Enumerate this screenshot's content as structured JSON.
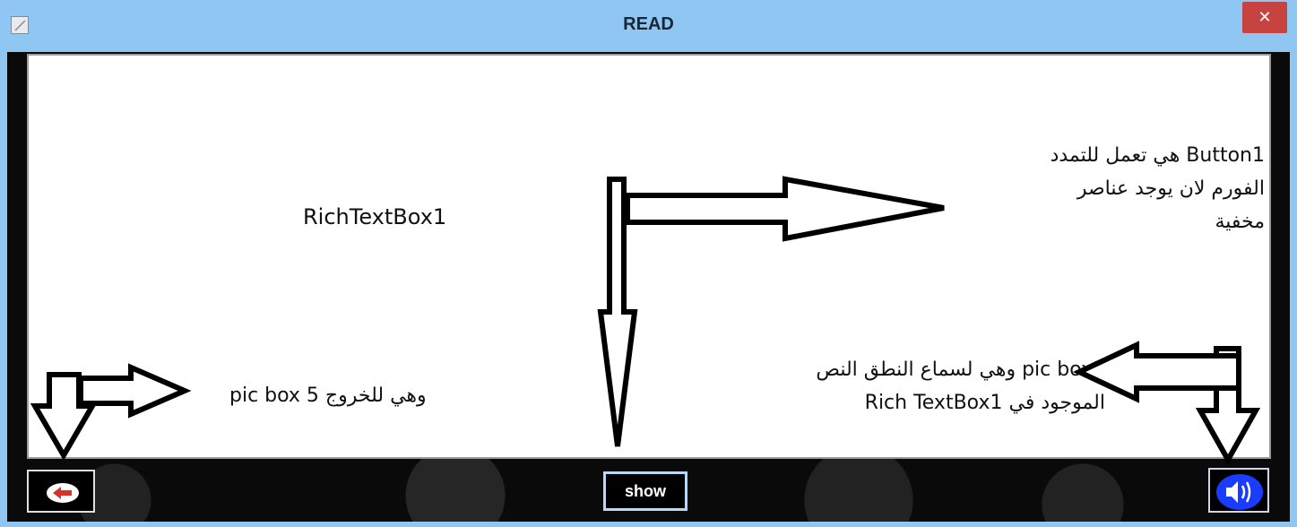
{
  "window": {
    "title": "READ",
    "close_glyph": "✕"
  },
  "rich_text_box": {
    "label": "RichTextBox1"
  },
  "annotations": {
    "button_note": [
      "Button1  هي تعمل للتمدد",
      "الفورم لان يوجد عناصر",
      "مخفية"
    ],
    "speaker_note": [
      "pic box1  وهي لسماع النطق النص",
      "الموجود في  Rich TextBox1"
    ],
    "exit_note": "pic box 5  وهي للخروج"
  },
  "bottom_bar": {
    "show_label": "show",
    "exit_icon": "exit-arrow-icon",
    "speaker_icon": "speaker-icon"
  },
  "colors": {
    "titlebar": "#8fc6f2",
    "close": "#c7433f",
    "speaker": "#1a3cff",
    "exit_arrow": "#d9322a"
  }
}
